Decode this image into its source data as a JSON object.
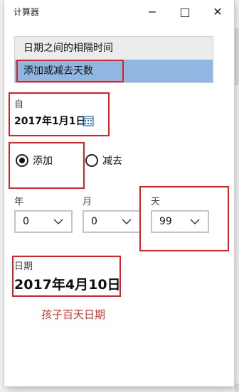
{
  "window": {
    "title": "计算器",
    "controls": [
      "−",
      "□",
      "✕"
    ]
  },
  "dropdown": {
    "items": [
      "日期之间的相隔时间",
      "添加或减去天数"
    ],
    "selected_index": 1
  },
  "from": {
    "label": "自",
    "date": "2017年1月1日",
    "icon": "calendar-icon"
  },
  "operation": {
    "add_label": "添加",
    "subtract_label": "减去",
    "selected": "add"
  },
  "fields": {
    "years_label": "年",
    "months_label": "月",
    "days_label": "天",
    "years_value": "0",
    "months_value": "0",
    "days_value": "99"
  },
  "result": {
    "label": "日期",
    "value": "2017年4月10日"
  },
  "annotation": {
    "note": "孩子百天日期"
  }
}
